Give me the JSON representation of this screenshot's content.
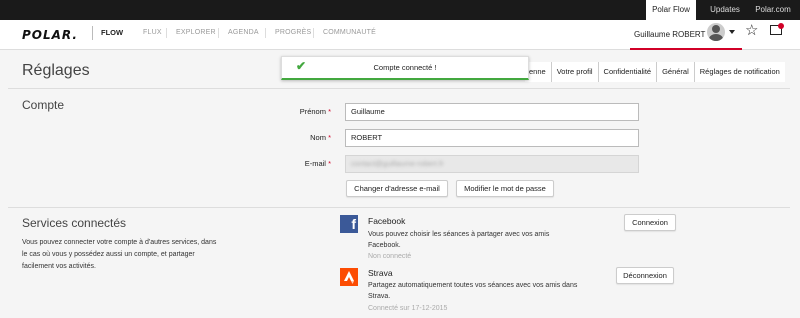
{
  "topbar": {
    "links": [
      "Polar Flow",
      "Updates",
      "Polar.com"
    ]
  },
  "nav": {
    "logo": "POLAR.",
    "product": "FLOW",
    "items": [
      "FLUX",
      "EXPLORER",
      "AGENDA",
      "PROGRÈS",
      "COMMUNAUTÉ"
    ],
    "user_name": "Guillaume ROBERT"
  },
  "page": {
    "title": "Réglages",
    "tabs": [
      "enne",
      "Votre profil",
      "Confidentialité",
      "Général",
      "Réglages de notification"
    ]
  },
  "toast": {
    "message": "Compte connecté !",
    "accent": "#43a83f"
  },
  "account": {
    "title": "Compte",
    "first_name_label": "Prénom",
    "first_name_value": "Guillaume",
    "last_name_label": "Nom",
    "last_name_value": "ROBERT",
    "email_label": "E-mail",
    "email_value": "contact@guillaume-robert.fr",
    "change_email_button": "Changer d'adresse e-mail",
    "change_password_button": "Modifier le mot de passe"
  },
  "services": {
    "title": "Services connectés",
    "description": "Vous pouvez connecter votre compte à d'autres services, dans le cas où vous y possédez aussi un compte, et partager facilement vos activités.",
    "items": [
      {
        "icon": "facebook-icon",
        "name": "Facebook",
        "description": "Vous pouvez choisir les séances à partager avec vos amis Facebook.",
        "status": "Non connecté",
        "button": "Connexion",
        "color": "#3b5998"
      },
      {
        "icon": "strava-icon",
        "name": "Strava",
        "description": "Partagez automatiquement toutes vos séances avec vos amis dans Strava.",
        "status": "Connecté sur 17-12-2015",
        "button": "Déconnexion",
        "color": "#fc4c02"
      }
    ]
  },
  "colors": {
    "brand_red": "#d10027"
  }
}
